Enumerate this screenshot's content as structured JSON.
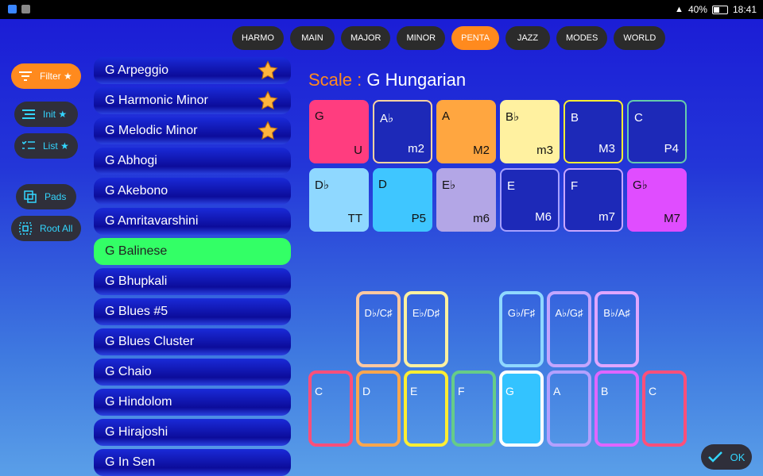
{
  "status": {
    "battery": "40%",
    "time": "18:41"
  },
  "tabs": [
    "HARMO",
    "MAIN",
    "MAJOR",
    "MINOR",
    "PENTA",
    "JAZZ",
    "MODES",
    "WORLD"
  ],
  "active_tab": "PENTA",
  "left": {
    "filter": "Filter ★",
    "init": "Init ★",
    "list": "List ★",
    "pads": "Pads",
    "root_all": "Root All"
  },
  "scales": [
    {
      "label": "G Arpeggio",
      "starred": true
    },
    {
      "label": "G Harmonic Minor",
      "starred": true
    },
    {
      "label": "G Melodic Minor",
      "starred": true
    },
    {
      "label": "G Abhogi",
      "starred": false
    },
    {
      "label": "G Akebono",
      "starred": false
    },
    {
      "label": "G Amritavarshini",
      "starred": false
    },
    {
      "label": "G Balinese",
      "starred": false,
      "selected": true
    },
    {
      "label": "G Bhupkali",
      "starred": false
    },
    {
      "label": "G Blues #5",
      "starred": false
    },
    {
      "label": "G Blues Cluster",
      "starred": false
    },
    {
      "label": "G Chaio",
      "starred": false
    },
    {
      "label": "G Hindolom",
      "starred": false
    },
    {
      "label": "G Hirajoshi",
      "starred": false
    },
    {
      "label": "G In Sen",
      "starred": false
    }
  ],
  "title": {
    "label": "Scale :",
    "value": "G Hungarian"
  },
  "intervals": [
    {
      "note": "G",
      "interval": "U",
      "color": "#ff3d7f",
      "filled": true
    },
    {
      "note": "A♭",
      "interval": "m2",
      "color": "#ffd3a0",
      "filled": false
    },
    {
      "note": "A",
      "interval": "M2",
      "color": "#ffa640",
      "filled": true
    },
    {
      "note": "B♭",
      "interval": "m3",
      "color": "#fff1a0",
      "filled": true
    },
    {
      "note": "B",
      "interval": "M3",
      "color": "#ffee33",
      "filled": false
    },
    {
      "note": "C",
      "interval": "P4",
      "color": "#66ccaa",
      "filled": false
    },
    {
      "note": "D♭",
      "interval": "TT",
      "color": "#8fd8ff",
      "filled": true
    },
    {
      "note": "D",
      "interval": "P5",
      "color": "#3fc6ff",
      "filled": true
    },
    {
      "note": "E♭",
      "interval": "m6",
      "color": "#b3a6e6",
      "filled": true
    },
    {
      "note": "E",
      "interval": "M6",
      "color": "#a6a0ff",
      "filled": false
    },
    {
      "note": "F",
      "interval": "m7",
      "color": "#c9a6ff",
      "filled": false
    },
    {
      "note": "G♭",
      "interval": "M7",
      "color": "#e04dff",
      "filled": true
    }
  ],
  "black_keys": [
    {
      "label": "D♭/C♯",
      "color": "#ffc8a0",
      "slot": 1
    },
    {
      "label": "E♭/D♯",
      "color": "#fff1a0",
      "slot": 2
    },
    {
      "label": "G♭/F♯",
      "color": "#8fd8ff",
      "slot": 4
    },
    {
      "label": "A♭/G♯",
      "color": "#c3a6ff",
      "slot": 5
    },
    {
      "label": "B♭/A♯",
      "color": "#e0a6ff",
      "slot": 6
    }
  ],
  "white_keys": [
    {
      "label": "C",
      "color": "#ff4f7a"
    },
    {
      "label": "D",
      "color": "#ffa64d"
    },
    {
      "label": "E",
      "color": "#ffee33"
    },
    {
      "label": "F",
      "color": "#66cc88"
    },
    {
      "label": "G",
      "color": "#ffffff",
      "fill": "#33c3ff"
    },
    {
      "label": "A",
      "color": "#b3a0ff"
    },
    {
      "label": "B",
      "color": "#e066ff"
    },
    {
      "label": "C",
      "color": "#ff4f7a"
    }
  ],
  "ok": "OK"
}
